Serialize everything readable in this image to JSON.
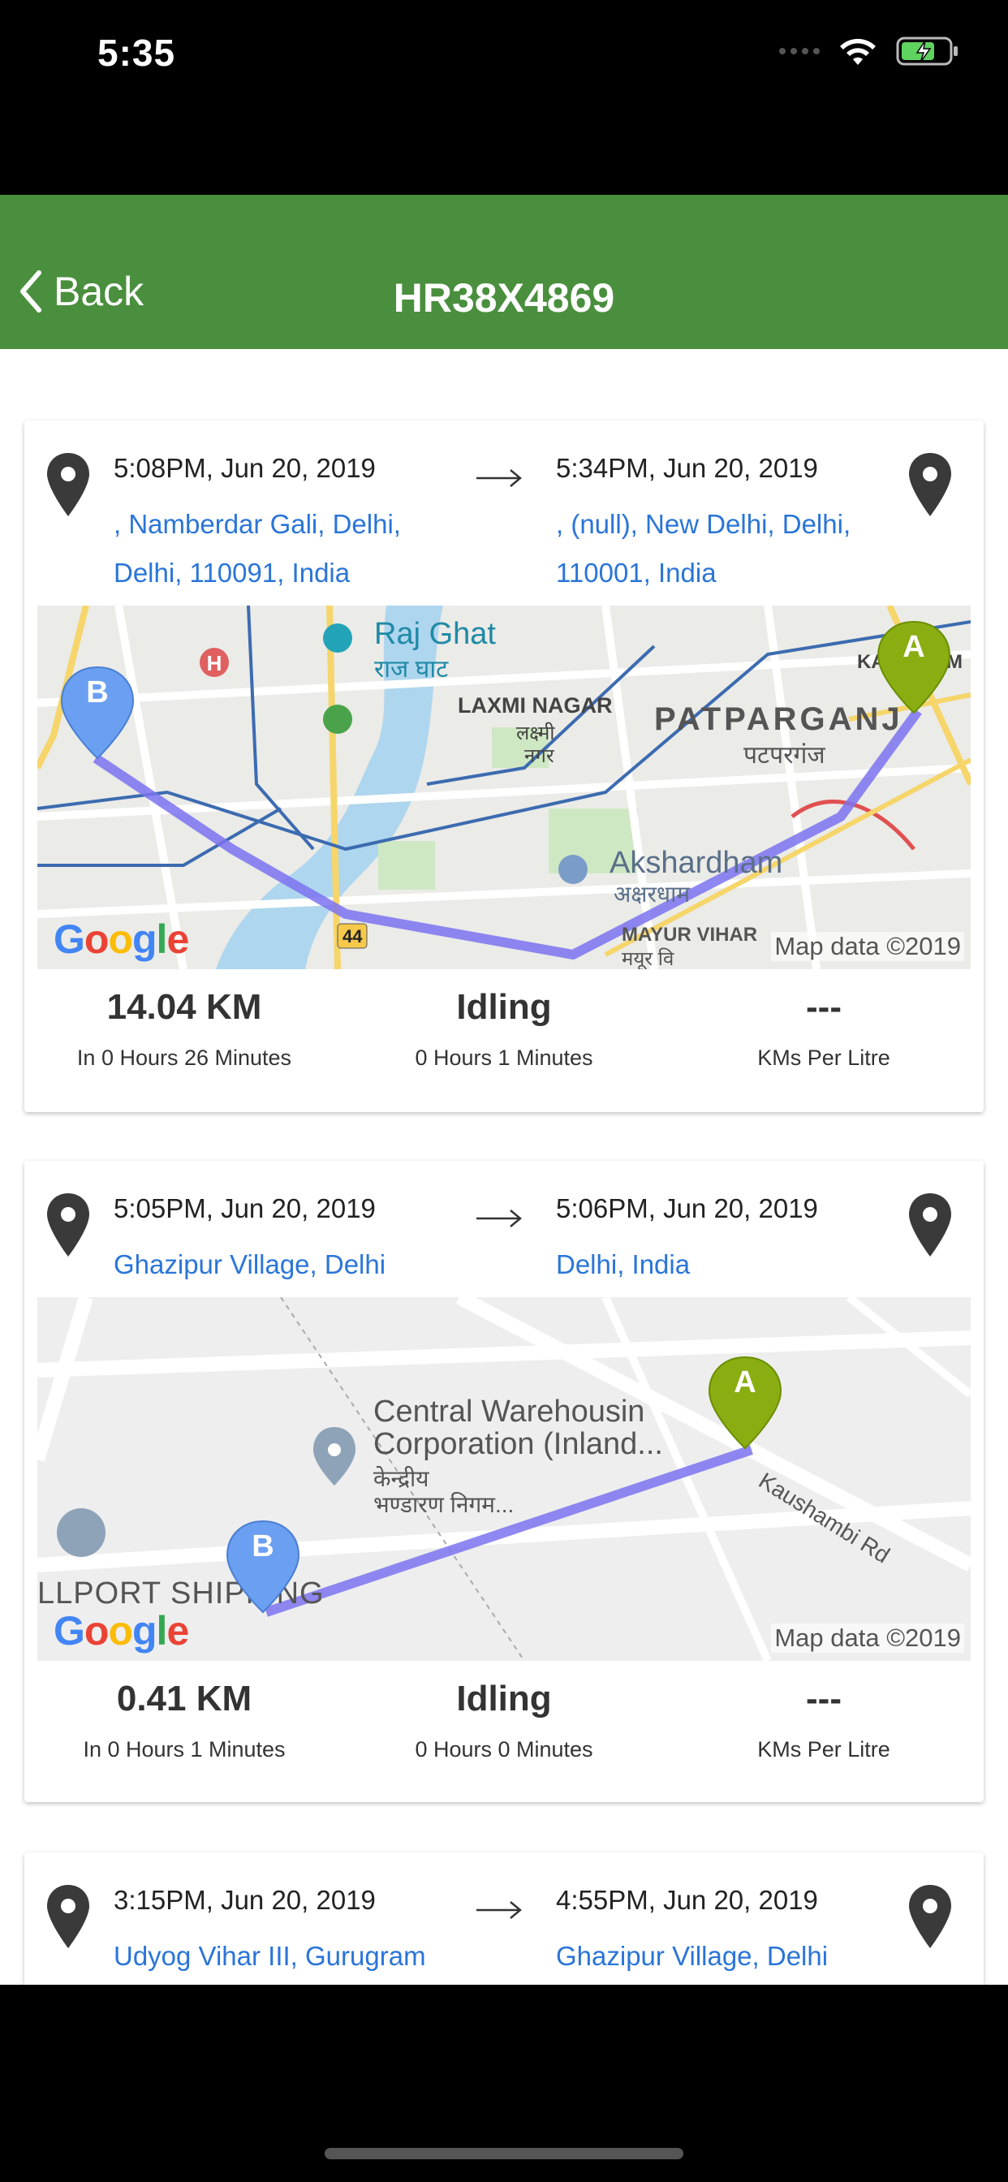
{
  "status_bar": {
    "time": "5:35"
  },
  "header": {
    "back_label": "Back",
    "title": "HR38X4869"
  },
  "colors": {
    "header": "#4a8f3e",
    "link": "#2a75d8",
    "route": "#7b73f0"
  },
  "trips": [
    {
      "start_time": "5:08PM, Jun 20, 2019",
      "start_address": ", Namberdar Gali, Delhi, Delhi, 110091, India",
      "end_time": "5:34PM, Jun 20, 2019",
      "end_address": ", (null), New Delhi, Delhi, 110001, India",
      "map_labels": {
        "l1": "Raj Ghat",
        "l2": "राज घाट",
        "l3": "LAXMI NAGAR",
        "l4": "लक्ष्मी",
        "l5": "नगर",
        "l6": "PATPARGANJ",
        "l7": "पटपरगंज",
        "l8": "Akshardham",
        "l9": "अक्षरधाम",
        "l10": "MAYUR VIHAR",
        "l11": "मयूर वि",
        "l12": "44",
        "l13": "KA",
        "l14": "M"
      },
      "map_attribution": "Map data ©2019",
      "distance": "14.04 KM",
      "duration": "In 0 Hours 26 Minutes",
      "idling_label": "Idling",
      "idling_time": "0 Hours 1 Minutes",
      "mileage": "---",
      "mileage_label": "KMs Per Litre"
    },
    {
      "start_time": "5:05PM, Jun 20, 2019",
      "start_address": "Ghazipur Village, Delhi",
      "end_time": "5:06PM, Jun 20, 2019",
      "end_address": "Delhi, India",
      "map_labels": {
        "l1": "Central Warehousin",
        "l2": "Corporation (Inland...",
        "l3": "केन्द्रीय",
        "l4": "भण्डारण निगम...",
        "l5": "Kaushambi Rd",
        "l6": "LLPORT SHIPPING"
      },
      "map_attribution": "Map data ©2019",
      "distance": "0.41 KM",
      "duration": "In 0 Hours 1 Minutes",
      "idling_label": "Idling",
      "idling_time": "0 Hours 0 Minutes",
      "mileage": "---",
      "mileage_label": "KMs Per Litre"
    },
    {
      "start_time": "3:15PM, Jun 20, 2019",
      "start_address": "Udyog Vihar III, Gurugram",
      "end_time": "4:55PM, Jun 20, 2019",
      "end_address": "Ghazipur Village, Delhi"
    }
  ],
  "markers": {
    "start": "A",
    "end": "B"
  },
  "google": {
    "g1": "G",
    "g2": "o",
    "g3": "o",
    "g4": "g",
    "g5": "l",
    "g6": "e"
  }
}
